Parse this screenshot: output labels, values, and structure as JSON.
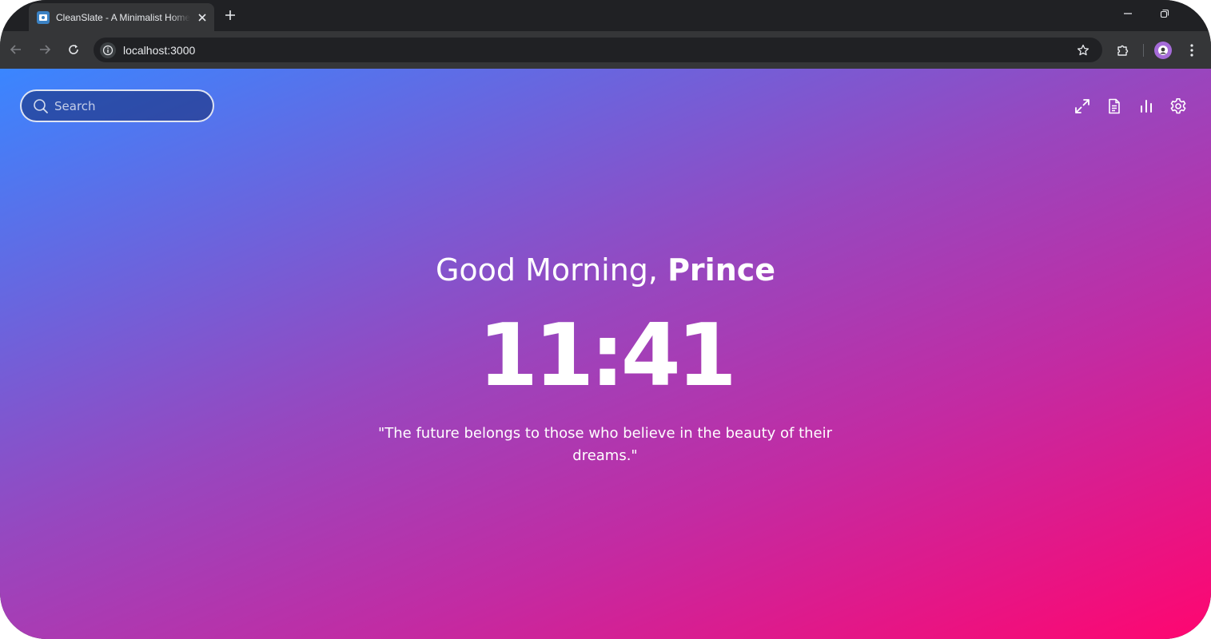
{
  "browser": {
    "tab": {
      "title": "CleanSlate - A Minimalist Homepage",
      "favicon": "page-favicon-icon",
      "close_icon": "close-icon"
    },
    "new_tab_icon": "plus-icon",
    "window_controls": [
      "minimize-icon",
      "restore-icon"
    ],
    "toolbar": {
      "back_icon": "arrow-left-icon",
      "forward_icon": "arrow-right-icon",
      "reload_icon": "reload-icon",
      "site_info_icon": "info-icon",
      "url": "localhost:3000",
      "bookmark_icon": "star-icon",
      "extensions_icon": "puzzle-icon",
      "profile_icon": "avatar",
      "menu_icon": "more-vertical-icon"
    }
  },
  "page": {
    "search": {
      "placeholder": "Search",
      "value": "",
      "icon": "search-icon"
    },
    "actions": [
      {
        "name": "fullscreen",
        "icon": "expand-icon"
      },
      {
        "name": "notes",
        "icon": "document-icon"
      },
      {
        "name": "stats",
        "icon": "bar-chart-icon"
      },
      {
        "name": "settings",
        "icon": "gear-icon"
      }
    ],
    "greeting": {
      "prefix": "Good Morning, ",
      "name": "Prince"
    },
    "clock": "11:41",
    "quote": "\"The future belongs to those who believe in the beauty of their dreams.\""
  },
  "colors": {
    "chrome_dark": "#202124",
    "chrome_toolbar": "#353638",
    "gradient_start": "#3a86ff",
    "gradient_mid": "#9747bf",
    "gradient_end": "#ff0670",
    "text": "#ffffff"
  }
}
